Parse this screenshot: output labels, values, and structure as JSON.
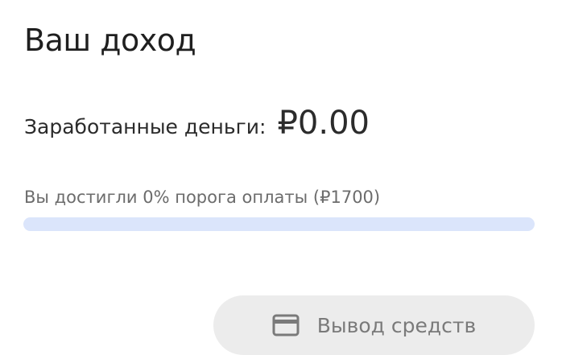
{
  "income": {
    "title": "Ваш доход",
    "earned_label": "Заработанные деньги:",
    "earned_value": "₽0.00",
    "threshold_text": "Вы достигли 0% порога оплаты (₽1700)",
    "progress_fraction": 0,
    "withdraw": {
      "label": "Вывод средств",
      "icon": "credit-card-icon",
      "enabled": false
    }
  },
  "colors": {
    "progress_track": "#dbe5fb",
    "progress_fill": "#4c7de0",
    "button_bg": "#ececec",
    "button_text": "#7a7a7a"
  }
}
